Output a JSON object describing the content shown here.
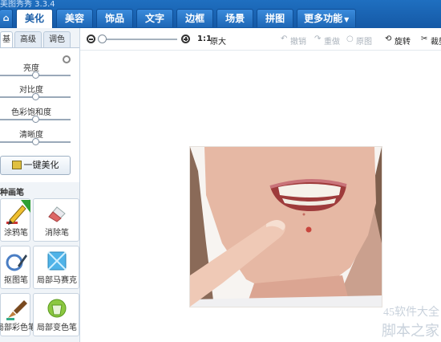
{
  "app": {
    "title": "美图秀秀 3.3.4"
  },
  "tabs": {
    "home_icon": "home-icon",
    "items": [
      "美化",
      "美容",
      "饰品",
      "文字",
      "边框",
      "场景",
      "拼图"
    ],
    "more": "更多功能"
  },
  "left_panel": {
    "subtabs": [
      "基础",
      "高级",
      "调色"
    ],
    "adjustments": [
      {
        "label": "亮度",
        "level": 0.5
      },
      {
        "label": "对比度",
        "level": 0.5
      },
      {
        "label": "色彩饱和度",
        "level": 0.5
      },
      {
        "label": "清晰度",
        "level": 0.5
      }
    ],
    "one_click": "一键美化",
    "section_title": "种画笔",
    "brushes": [
      {
        "label": "涂鸦笔",
        "icon": "doodle-pen-icon",
        "new": true
      },
      {
        "label": "消除笔",
        "icon": "eraser-icon",
        "new": false
      },
      {
        "label": "抠图笔",
        "icon": "cutout-pen-icon",
        "new": false
      },
      {
        "label": "局部马赛克",
        "icon": "mosaic-icon",
        "new": false
      },
      {
        "label": "局部彩色笔",
        "icon": "color-brush-icon",
        "new": false
      },
      {
        "label": "局部变色笔",
        "icon": "recolor-bucket-icon",
        "new": false
      }
    ]
  },
  "toolbar": {
    "zoom_level": 0.03,
    "ratio": "1:1",
    "fit": "原大",
    "undo": "撤销",
    "redo": "重做",
    "original": "原图",
    "rotate": "旋转",
    "crop": "裁剪"
  },
  "watermark": {
    "line1": "45软件大全",
    "line2": "脚本之家"
  },
  "colors": {
    "tab_bar": "#1f6fc0",
    "active_tab_text": "#1a5ea8",
    "panel_bg": "#f0f4f8"
  }
}
